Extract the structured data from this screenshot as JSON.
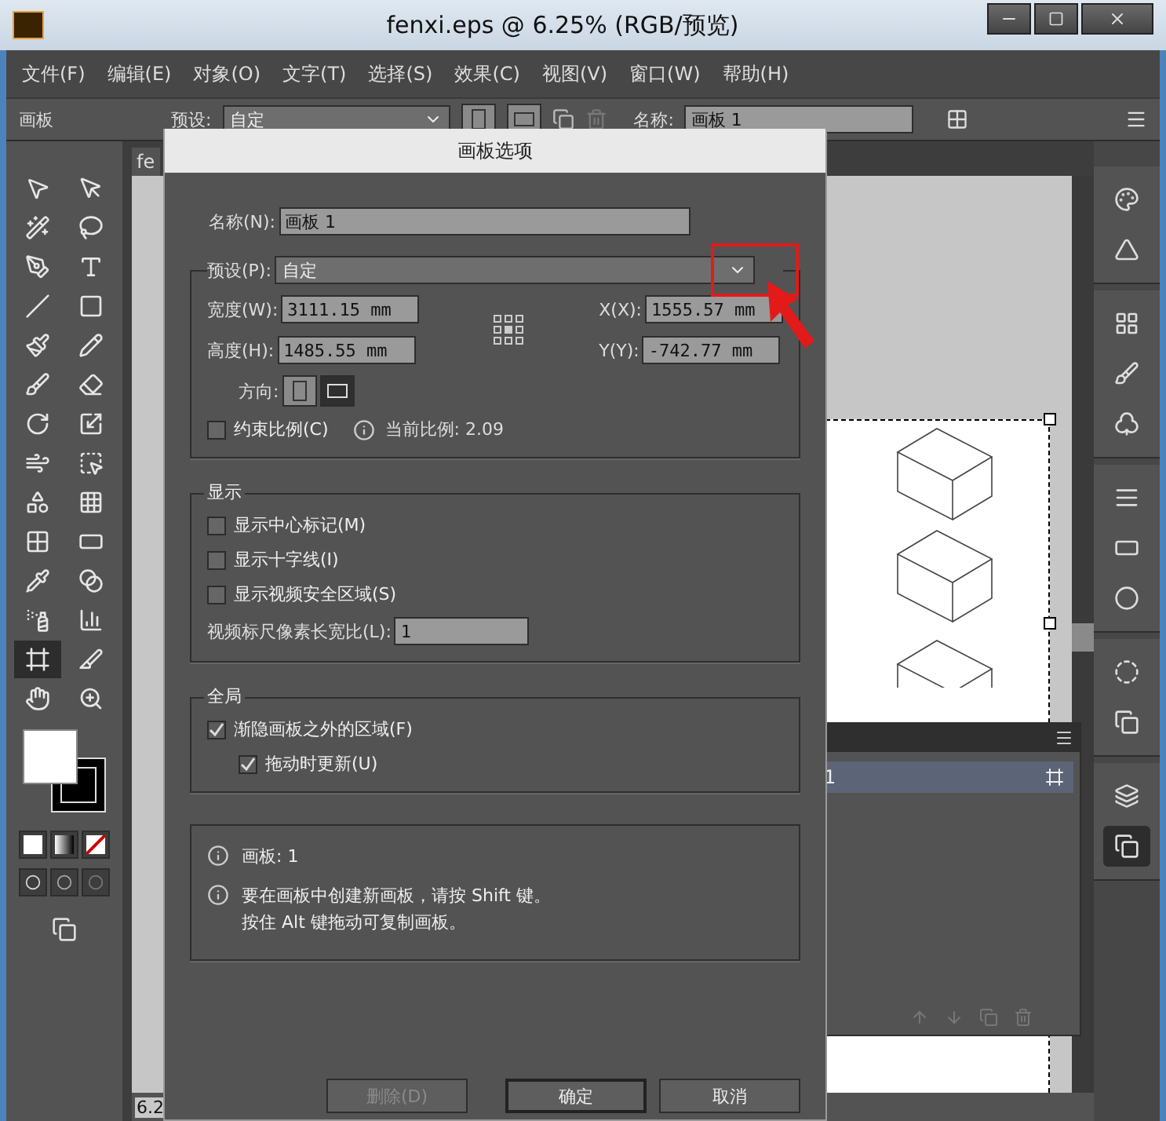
{
  "window": {
    "title": "fenxi.eps @ 6.25% (RGB/预览)"
  },
  "menu": [
    "文件(F)",
    "编辑(E)",
    "对象(O)",
    "文字(T)",
    "选择(S)",
    "效果(C)",
    "视图(V)",
    "窗口(W)",
    "帮助(H)"
  ],
  "control_bar": {
    "panel_label": "画板",
    "preset_label": "预设:",
    "preset_value": "自定",
    "name_label": "名称:",
    "name_value": "画板 1"
  },
  "tools": [
    {
      "selected": false
    },
    {
      "selected": false
    },
    {
      "selected": false
    },
    {
      "selected": false
    },
    {
      "selected": false
    },
    {
      "selected": false
    },
    {
      "selected": false
    },
    {
      "selected": false
    },
    {
      "selected": false
    },
    {
      "selected": false
    },
    {
      "selected": false
    },
    {
      "selected": false
    },
    {
      "selected": false
    },
    {
      "selected": false
    },
    {
      "selected": false
    },
    {
      "selected": false
    },
    {
      "selected": false
    },
    {
      "selected": false
    },
    {
      "selected": false
    },
    {
      "selected": false
    },
    {
      "selected": false
    },
    {
      "selected": false
    },
    {
      "selected": false
    },
    {
      "selected": false
    },
    {
      "selected": true
    },
    {
      "selected": false
    },
    {
      "selected": false
    },
    {
      "selected": false
    }
  ],
  "document_tab": "fe",
  "zoom": "6.2",
  "artboards_panel": {
    "rows": [
      {
        "name": "1",
        "selected": true
      }
    ]
  },
  "dialog": {
    "title": "画板选项",
    "name_label": "名称(N):",
    "name_value": "画板 1",
    "preset_label": "预设(P):",
    "preset_value": "自定",
    "width_label": "宽度(W):",
    "width_value": "3111.15 mm",
    "height_label": "高度(H):",
    "height_value": "1485.55 mm",
    "x_label": "X(X):",
    "x_value": "1555.57 mm",
    "y_label": "Y(Y):",
    "y_value": "-742.77 mm",
    "orientation_label": "方向:",
    "orientation": [
      {
        "selected": false
      },
      {
        "selected": true
      }
    ],
    "constrain": {
      "label": "约束比例(C)",
      "checked": false
    },
    "ratio_text": "当前比例: 2.09",
    "display": {
      "title": "显示",
      "options": [
        {
          "label": "显示中心标记(M)",
          "checked": false
        },
        {
          "label": "显示十字线(I)",
          "checked": false
        },
        {
          "label": "显示视频安全区域(S)",
          "checked": false
        }
      ],
      "video_ratio_label": "视频标尺像素长宽比(L):",
      "video_ratio_value": "1"
    },
    "global": {
      "title": "全局",
      "options": [
        {
          "label": "渐隐画板之外的区域(F)",
          "checked": true,
          "children": [
            {
              "label": "拖动时更新(U)",
              "checked": true
            }
          ]
        }
      ]
    },
    "info": [
      {
        "lines": [
          "画板: 1"
        ]
      },
      {
        "lines": [
          "要在画板中创建新画板，请按 Shift 键。",
          "按住 Alt 键拖动可复制画板。"
        ]
      }
    ],
    "buttons": [
      {
        "label": "删除(D)",
        "disabled": true,
        "primary": false
      },
      {
        "label": "确定",
        "disabled": false,
        "primary": true
      },
      {
        "label": "取消",
        "disabled": false,
        "primary": false
      }
    ]
  }
}
